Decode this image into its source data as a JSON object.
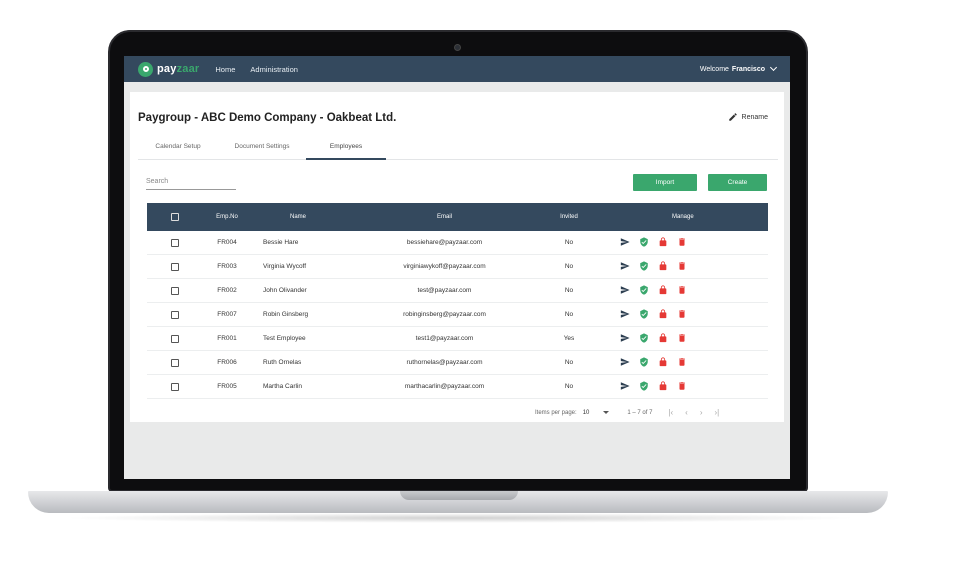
{
  "header": {
    "logo_a": "pay",
    "logo_b": "zaar",
    "nav": [
      "Home",
      "Administration"
    ],
    "welcome_prefix": "Welcome",
    "user_name": "Francisco"
  },
  "page": {
    "title": "Paygroup - ABC Demo Company - Oakbeat Ltd.",
    "rename_label": "Rename"
  },
  "tabs": [
    {
      "label": "Calendar Setup",
      "active": false
    },
    {
      "label": "Document Settings",
      "active": false
    },
    {
      "label": "Employees",
      "active": true
    }
  ],
  "search": {
    "placeholder": "Search"
  },
  "actions": {
    "import_label": "Import",
    "create_label": "Create"
  },
  "table": {
    "columns": {
      "emp_no": "Emp.No",
      "name": "Name",
      "email": "Email",
      "invited": "Invited",
      "manage": "Manage"
    },
    "rows": [
      {
        "emp_no": "FR004",
        "name": "Bessie Hare",
        "email": "bessiehare@payzaar.com",
        "invited": "No"
      },
      {
        "emp_no": "FR003",
        "name": "Virginia Wycoff",
        "email": "virginiawykoff@payzaar.com",
        "invited": "No"
      },
      {
        "emp_no": "FR002",
        "name": "John Olivander",
        "email": "test@payzaar.com",
        "invited": "No"
      },
      {
        "emp_no": "FR007",
        "name": "Robin Ginsberg",
        "email": "robinginsberg@payzaar.com",
        "invited": "No"
      },
      {
        "emp_no": "FR001",
        "name": "Test Employee",
        "email": "test1@payzaar.com",
        "invited": "Yes"
      },
      {
        "emp_no": "FR006",
        "name": "Ruth Ornelas",
        "email": "ruthornelas@payzaar.com",
        "invited": "No"
      },
      {
        "emp_no": "FR005",
        "name": "Martha Carlin",
        "email": "marthacarlin@payzaar.com",
        "invited": "No"
      }
    ]
  },
  "pager": {
    "items_label": "Items per page:",
    "items_value": "10",
    "range": "1 – 7 of 7"
  },
  "icons": {
    "send": "send-icon",
    "shield": "shield-check-icon",
    "lock": "lock-icon",
    "delete": "trash-icon"
  },
  "colors": {
    "nav_bg": "#34495e",
    "accent": "#3aa76d",
    "danger": "#e53935"
  }
}
